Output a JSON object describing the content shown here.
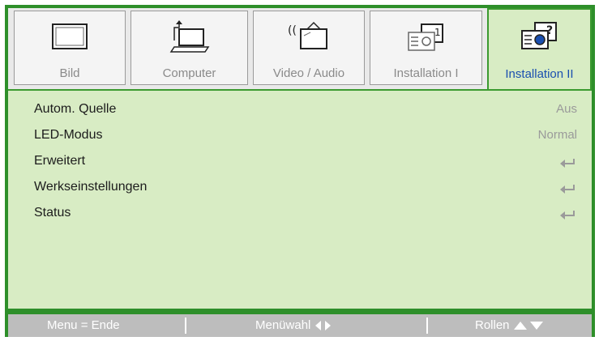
{
  "tabs": [
    {
      "label": "Bild",
      "icon": "monitor-icon",
      "active": false
    },
    {
      "label": "Computer",
      "icon": "laptop-icon",
      "active": false
    },
    {
      "label": "Video / Audio",
      "icon": "tv-signal-icon",
      "active": false
    },
    {
      "label": "Installation I",
      "icon": "projector-icon",
      "active": false
    },
    {
      "label": "Installation II",
      "icon": "projector-help-icon",
      "active": true
    }
  ],
  "menu": [
    {
      "label": "Autom. Quelle",
      "value": "Aus"
    },
    {
      "label": "LED-Modus",
      "value": "Normal"
    },
    {
      "label": "Erweitert",
      "value": "",
      "icon": "enter-icon"
    },
    {
      "label": "Werkseinstellungen",
      "value": "",
      "icon": "enter-icon"
    },
    {
      "label": "Status",
      "value": "",
      "icon": "enter-icon"
    }
  ],
  "statusbar": {
    "exit": "Menu = Ende",
    "select": "Menüwahl",
    "scroll": "Rollen"
  },
  "colors": {
    "frame": "#2e8f2a",
    "panel": "#d8ecc4",
    "active_label": "#1a4fb0",
    "statusbar": "#bdbdbd"
  }
}
